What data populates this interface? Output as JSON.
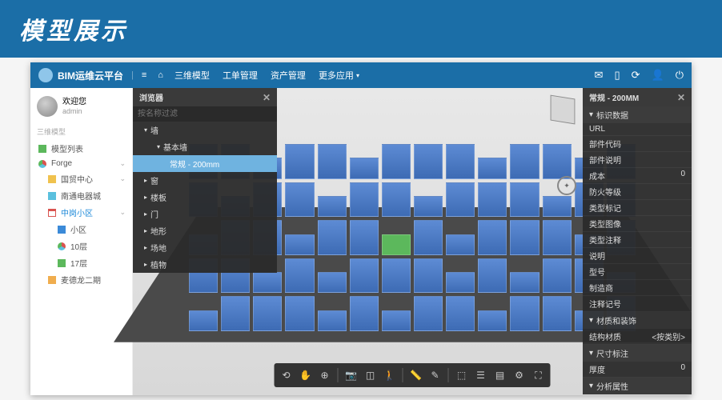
{
  "banner_title": "模型展示",
  "app_name": "BIM运维云平台",
  "top_menu": [
    "首页",
    "三维模型",
    "工单管理",
    "资产管理",
    "更多应用"
  ],
  "user": {
    "welcome": "欢迎您",
    "name": "admin"
  },
  "sidebar": {
    "section": "三维模型",
    "model_list": "模型列表",
    "forge": "Forge",
    "items": {
      "guomao": "国贸中心",
      "nantong": "南通电器城",
      "zhonggang": "中岗小区",
      "xiaoqu": "小区",
      "layer10": "10层",
      "layer17": "17层",
      "maidelong": "麦德龙二期"
    }
  },
  "browser": {
    "title": "浏览器",
    "search_placeholder": "按名称过滤",
    "tree": {
      "wall": "墙",
      "basic_wall": "基本墙",
      "selected": "常规 - 200mm",
      "window": "窗",
      "floor": "楼板",
      "door": "门",
      "terrain": "地形",
      "site": "场地",
      "plant": "植物"
    }
  },
  "props": {
    "title": "常规 - 200MM",
    "groups": {
      "identity": "标识数据",
      "mat": "材质和装饰",
      "dim": "尺寸标注",
      "analysis": "分析属性"
    },
    "rows": {
      "url": "URL",
      "part_code": "部件代码",
      "part_desc": "部件说明",
      "cost": "成本",
      "cost_val": "0",
      "fire": "防火等级",
      "type_mark": "类型标记",
      "type_image": "类型图像",
      "type_note": "类型注释",
      "desc": "说明",
      "model": "型号",
      "maker": "制造商",
      "note_mark": "注释记号",
      "struct_mat": "结构材质",
      "struct_mat_val": "<按类别>",
      "thickness": "厚度",
      "thickness_val": "0"
    }
  },
  "toolbar_icons": [
    "orbit",
    "pan",
    "zoom",
    "camera",
    "section",
    "first-person",
    "measure",
    "edit",
    "explode",
    "model-browser",
    "properties",
    "settings",
    "fullscreen"
  ]
}
